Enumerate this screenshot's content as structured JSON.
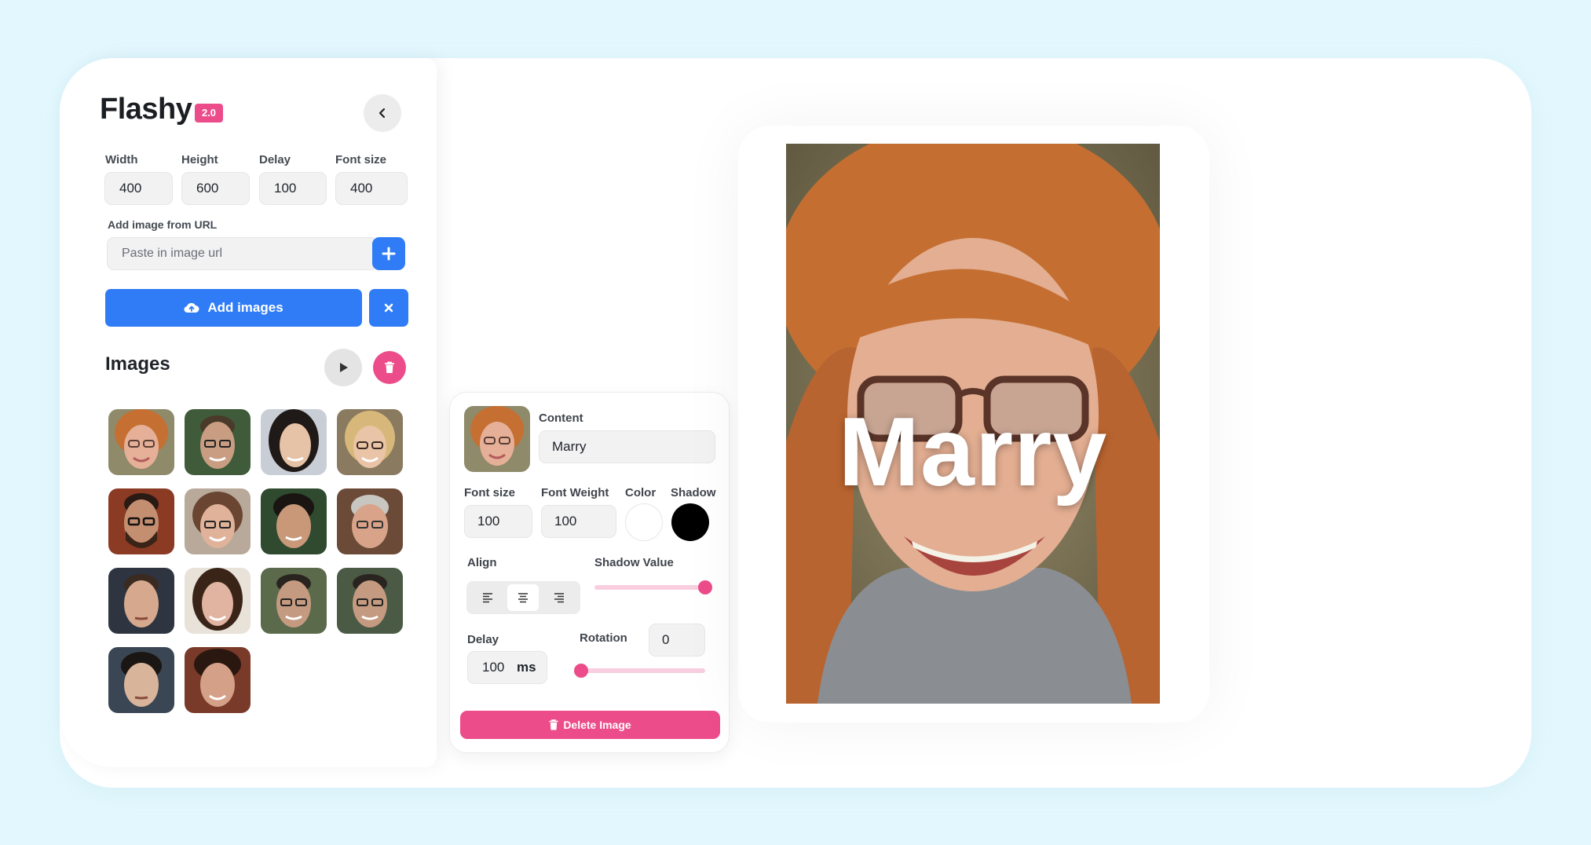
{
  "app": {
    "name": "Flashy",
    "version": "2.0"
  },
  "settings": {
    "width_label": "Width",
    "width_value": "400",
    "height_label": "Height",
    "height_value": "600",
    "delay_label": "Delay",
    "delay_value": "100",
    "font_size_label": "Font size",
    "font_size_value": "400"
  },
  "url": {
    "label": "Add image from URL",
    "placeholder": "Paste in image url"
  },
  "actions": {
    "add_images_label": "Add images"
  },
  "images": {
    "title": "Images",
    "count": 14
  },
  "editor": {
    "content_label": "Content",
    "content_value": "Marry",
    "font_size_label": "Font size",
    "font_size_value": "100",
    "font_weight_label": "Font Weight",
    "font_weight_value": "100",
    "color_label": "Color",
    "color_value": "#ffffff",
    "shadow_label": "Shadow",
    "shadow_value_color": "#000000",
    "align_label": "Align",
    "align_selected": "center",
    "shadow_value_label": "Shadow Value",
    "shadow_value_fraction": 0.95,
    "delay_label": "Delay",
    "delay_value": "100",
    "delay_unit": "ms",
    "rotation_label": "Rotation",
    "rotation_value": "0",
    "rotation_fraction": 0.0,
    "delete_label": "Delete Image"
  },
  "preview": {
    "overlay_text": "Marry"
  },
  "colors": {
    "accent_blue": "#2f7cf6",
    "accent_pink": "#ec4d8a",
    "background": "#e3f8fe"
  }
}
